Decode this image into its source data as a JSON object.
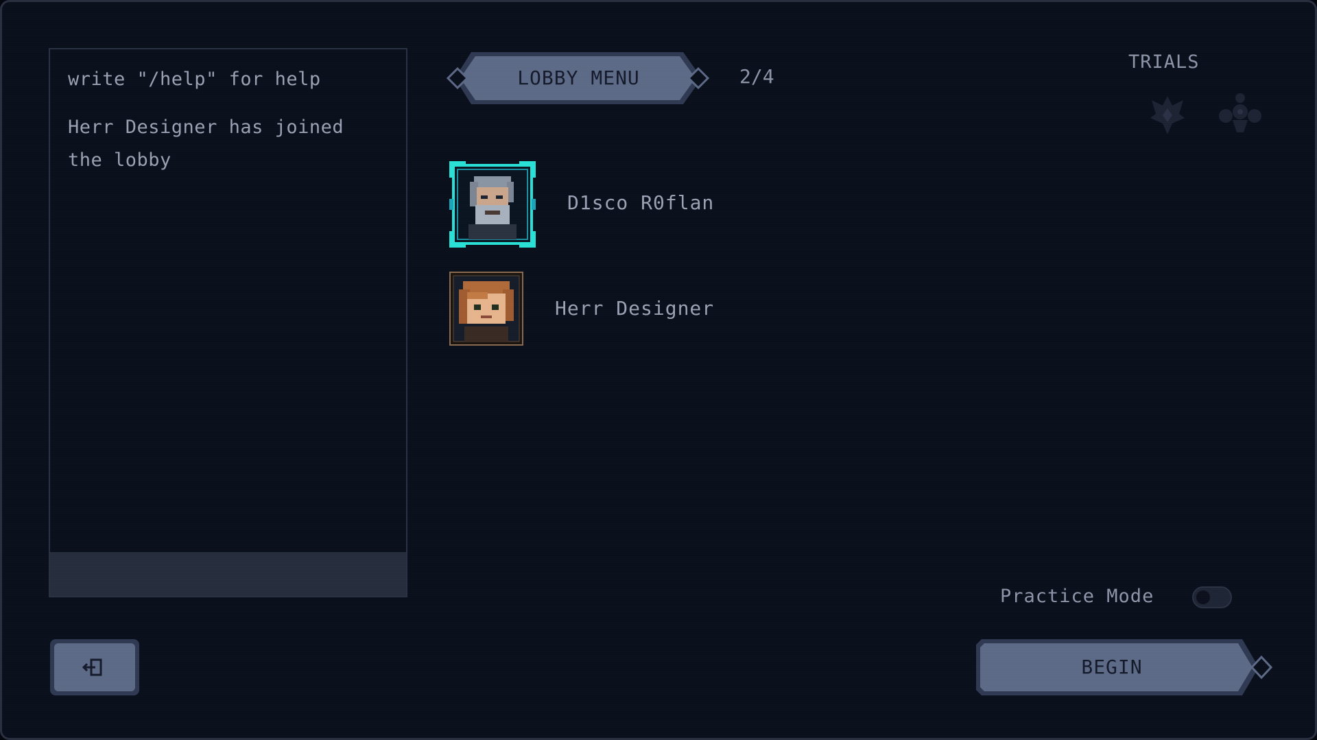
{
  "chat": {
    "hint": "write \"/help\" for help",
    "messages": [
      "Herr Designer has joined the lobby"
    ],
    "input_value": ""
  },
  "lobby": {
    "title": "LOBBY MENU",
    "player_count": "2/4"
  },
  "trials": {
    "label": "TRIALS",
    "icons": [
      "crest-icon",
      "fleur-icon"
    ]
  },
  "players": [
    {
      "name": "D1sco R0flan",
      "avatar": "bearded-man-portrait",
      "highlighted": true
    },
    {
      "name": "Herr Designer",
      "avatar": "auburn-hair-portrait",
      "highlighted": false
    }
  ],
  "practice_mode": {
    "label": "Practice Mode",
    "enabled": false
  },
  "buttons": {
    "exit_icon": "exit-door-icon",
    "begin_label": "BEGIN"
  },
  "colors": {
    "background": "#0a0f1c",
    "button_fill": "#5d6a87",
    "button_border": "#2f3952",
    "highlight_frame": "#29e0d6"
  }
}
